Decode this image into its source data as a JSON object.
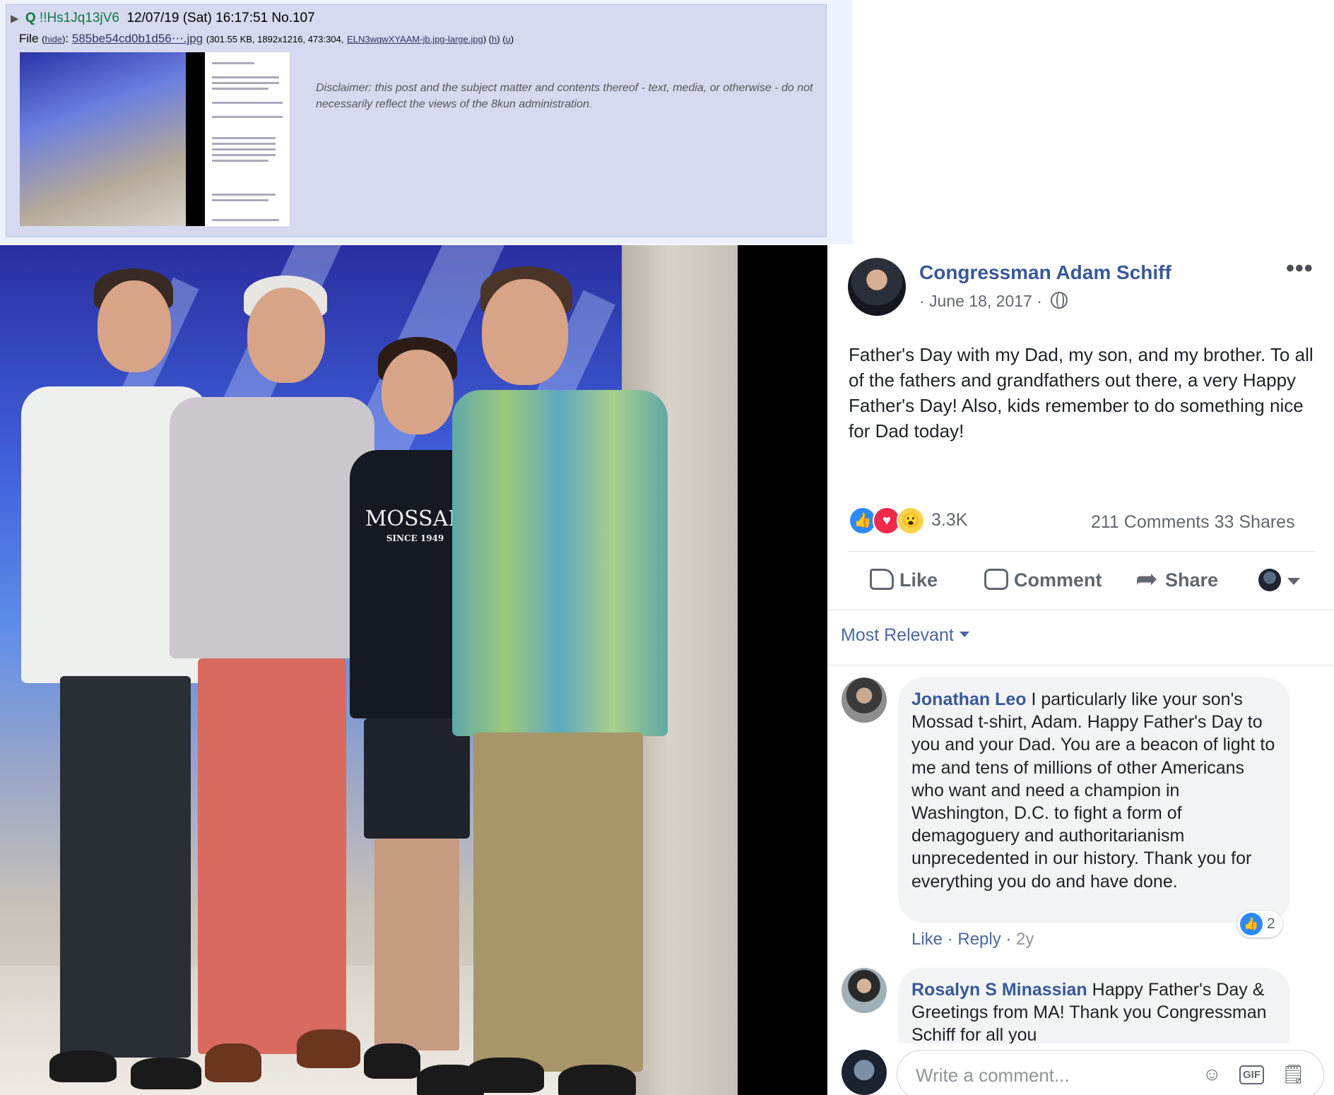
{
  "post": {
    "triangle": "▶",
    "name": "Q",
    "tripcode": "!!Hs1Jq13jV6",
    "datetime": "12/07/19 (Sat) 16:17:51",
    "post_no": "No.107",
    "file_label": "File",
    "hide_label": "hide",
    "file_name": "585be54cd0b1d56⋯.jpg",
    "file_meta": "(301.55 KB, 1892x1216, 473:304,",
    "orig_file": "ELN3wqwXYAAM-jb.jpg-large.jpg",
    "h_link": "h",
    "u_link": "u",
    "disclaimer": "Disclaimer: this post and the subject matter and contents thereof - text, media, or otherwise - do not necessarily reflect the views of the 8kun administration."
  },
  "photo": {
    "shirt_text": "MOSSAD",
    "shirt_subtext": "SINCE 1949"
  },
  "fb": {
    "page_name": "Congressman Adam Schiff",
    "date": "· June 18, 2017 ·",
    "more": "•••",
    "post_text": "Father's Day with my Dad, my son, and my brother. To all of the fathers and grandfathers out there, a very Happy Father's Day! Also, kids remember to do something nice for Dad today!",
    "reaction_count": "3.3K",
    "comments_shares": "211 Comments  33 Shares",
    "actions": {
      "like": "Like",
      "comment": "Comment",
      "share": "Share"
    },
    "sort_label": "Most Relevant",
    "comments": [
      {
        "author": "Jonathan Leo",
        "text": " I particularly like your son's Mossad t-shirt, Adam. Happy Father's Day to you and your Dad. You are a beacon of light to me and tens of millions of other Americans who want and need a champion in Washington, D.C. to fight a form of demagoguery and authoritarianism unprecedented in our history. Thank you for everything you do and have done.",
        "like": "Like",
        "reply": "Reply",
        "time": "2y",
        "reactions": "2"
      },
      {
        "author": "Rosalyn S Minassian",
        "text": " Happy Father's Day & Greetings from MA! Thank you Congressman Schiff for all you"
      }
    ],
    "write_placeholder": "Write a comment..."
  },
  "colors": {
    "board_bg": "#d6daf0",
    "trip_green": "#117743",
    "fb_blue": "#385898",
    "like_blue": "#2e89ff"
  }
}
